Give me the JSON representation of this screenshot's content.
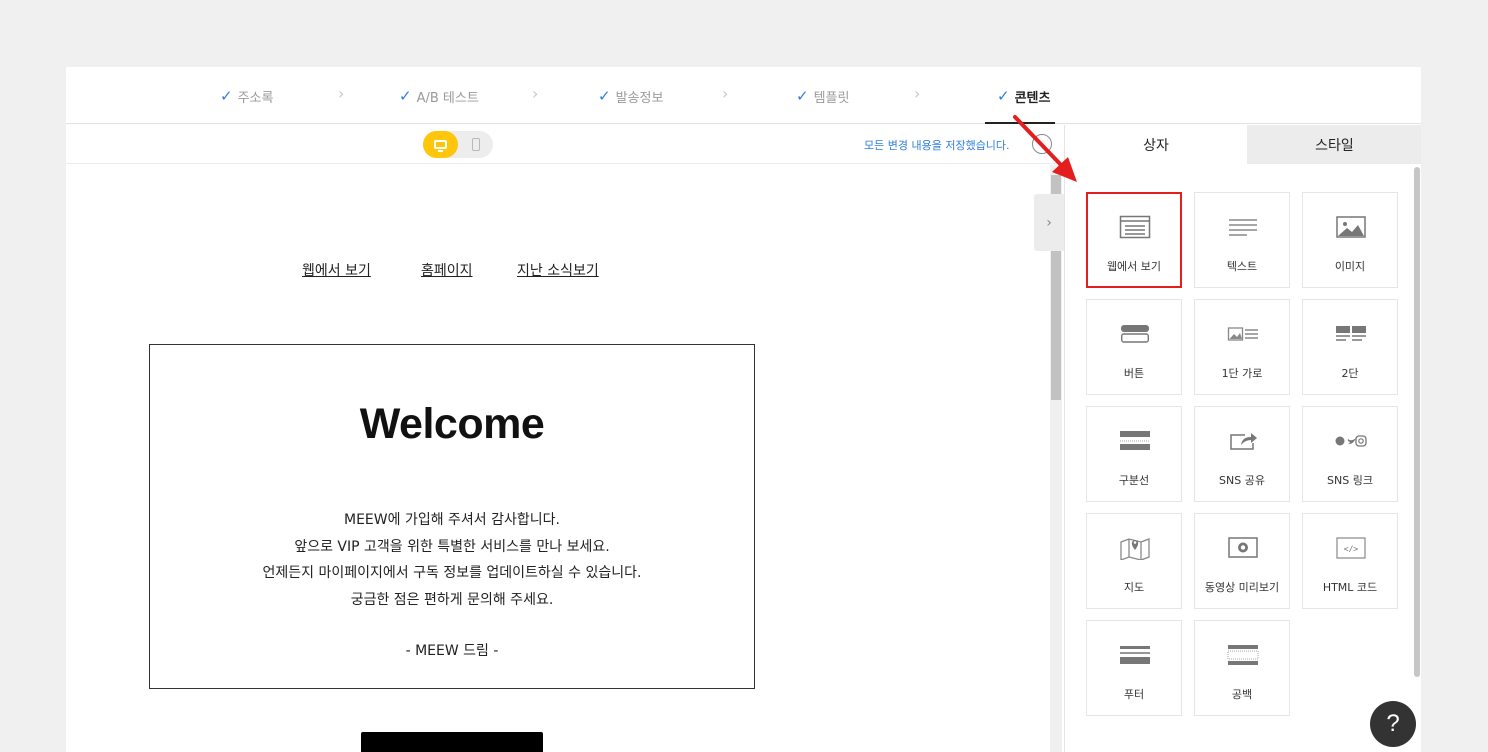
{
  "stepper": {
    "steps": [
      {
        "label": "주소록",
        "active": false
      },
      {
        "label": "A/B 테스트",
        "active": false
      },
      {
        "label": "발송정보",
        "active": false
      },
      {
        "label": "템플릿",
        "active": false
      },
      {
        "label": "콘텐츠",
        "active": true
      }
    ],
    "check_glyph": "✓",
    "separator_glyph": "›"
  },
  "toolbar": {
    "save_status": "모든 변경 내용을 저장했습니다.",
    "device_mode": "desktop",
    "device_options": [
      "desktop",
      "mobile"
    ]
  },
  "email": {
    "links": [
      "웹에서 보기",
      "홈페이지",
      "지난 소식보기"
    ],
    "welcome_title": "Welcome",
    "body_lines": [
      "MEEW에 가입해 주셔서 감사합니다.",
      "앞으로 VIP 고객을 위한 특별한 서비스를 만나 보세요.",
      "언제든지 마이페이지에서 구독 정보를 업데이트하실 수 있습니다.",
      "궁금한 점은 편하게 문의해 주세요."
    ],
    "signature": "- MEEW 드림 -"
  },
  "panel": {
    "tabs": [
      "상자",
      "스타일"
    ],
    "active_tab": "상자",
    "tiles": [
      {
        "label": "웹에서 보기",
        "icon": "browser-window-icon",
        "highlighted": true
      },
      {
        "label": "텍스트",
        "icon": "text-lines-icon",
        "highlighted": false
      },
      {
        "label": "이미지",
        "icon": "image-icon",
        "highlighted": false
      },
      {
        "label": "버튼",
        "icon": "button-icon",
        "highlighted": false
      },
      {
        "label": "1단 가로",
        "icon": "image-text-row-icon",
        "highlighted": false
      },
      {
        "label": "2단",
        "icon": "two-column-icon",
        "highlighted": false
      },
      {
        "label": "구분선",
        "icon": "divider-icon",
        "highlighted": false
      },
      {
        "label": "SNS 공유",
        "icon": "share-icon",
        "highlighted": false
      },
      {
        "label": "SNS 링크",
        "icon": "social-links-icon",
        "highlighted": false
      },
      {
        "label": "지도",
        "icon": "map-icon",
        "highlighted": false
      },
      {
        "label": "동영상 미리보기",
        "icon": "video-icon",
        "highlighted": false
      },
      {
        "label": "HTML 코드",
        "icon": "code-icon",
        "highlighted": false
      },
      {
        "label": "푸터",
        "icon": "footer-icon",
        "highlighted": false
      },
      {
        "label": "공백",
        "icon": "spacer-icon",
        "highlighted": false
      }
    ]
  },
  "help": {
    "label": "?"
  },
  "annotation": {
    "arrow_color": "#e41e1e",
    "highlight_color": "#e41e1e"
  },
  "colors": {
    "accent": "#2f7de1",
    "device_active": "#ffc60b"
  }
}
